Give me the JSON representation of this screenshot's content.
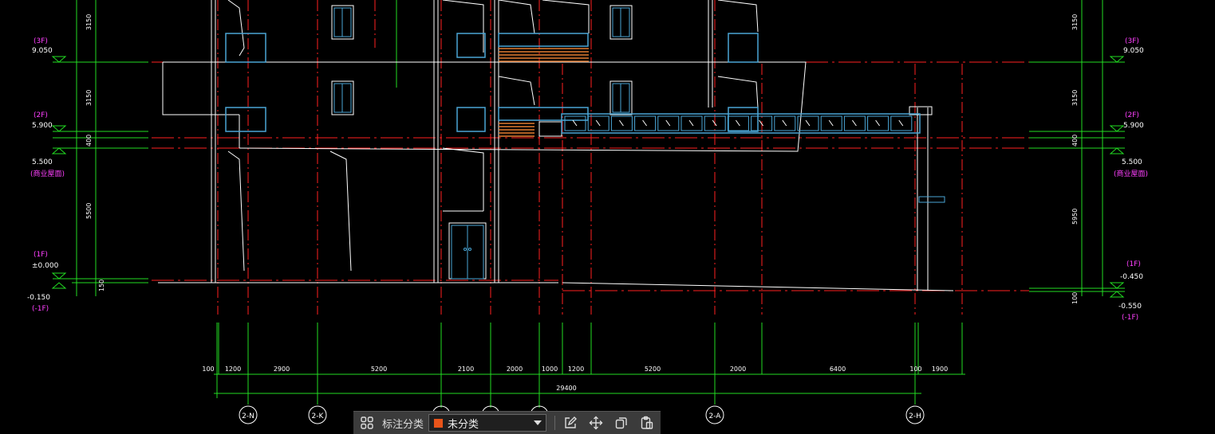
{
  "drawing": {
    "levels_left": [
      {
        "floor": "(3F)",
        "elevation": "9.050"
      },
      {
        "floor": "(2F)",
        "elevation": "5.900"
      },
      {
        "elevation": "5.500",
        "note": "(商业屋面)"
      },
      {
        "floor": "(1F)",
        "elevation": "±0.000"
      },
      {
        "elevation": "-0.150",
        "floor": "(-1F)"
      }
    ],
    "levels_right": [
      {
        "floor": "(3F)",
        "elevation": "9.050"
      },
      {
        "floor": "(2F)",
        "elevation": "5.900"
      },
      {
        "elevation": "5.500",
        "note": "(商业屋面)"
      },
      {
        "floor": "(1F)",
        "elevation": "-0.450"
      },
      {
        "elevation": "-0.550",
        "floor": "(-1F)"
      }
    ],
    "vertical_dims_left": [
      "3150",
      "3150",
      "400",
      "5500",
      "150"
    ],
    "vertical_dims_right": [
      "3150",
      "3150",
      "400",
      "5950",
      "100"
    ],
    "horizontal_dims": [
      "100",
      "1200",
      "2900",
      "5200",
      "2100",
      "2000",
      "1000",
      "1200",
      "5200",
      "2000",
      "6400",
      "100",
      "1900"
    ],
    "total_dim": "29400",
    "axis_labels": [
      "2-N",
      "2-K",
      "2-A",
      "2-H"
    ],
    "colors": {
      "axis_red": "#ff2020",
      "line_white": "#ffffff",
      "dim_green": "#22dd22",
      "level_magenta": "#ff40ff",
      "glass_blue": "#4aa6d6",
      "wood_orange": "#e07a30",
      "toolbar_bg": "#3b3b3b",
      "swatch": "#e8541a"
    }
  },
  "toolbar": {
    "grid_icon": "grid-icon",
    "label": "标注分类",
    "category_value": "未分类",
    "dropdown_icon": "caret-down-icon",
    "tools": [
      "edit-icon",
      "move-icon",
      "copy-icon",
      "paste-icon"
    ]
  }
}
